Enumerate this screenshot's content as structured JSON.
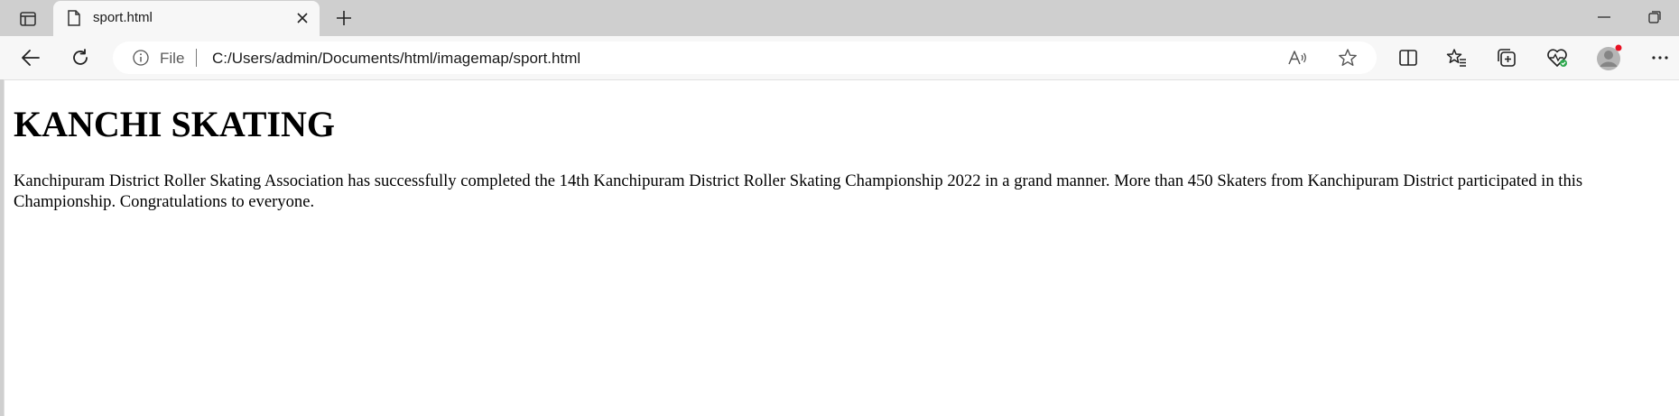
{
  "browser": {
    "tab": {
      "title": "sport.html"
    },
    "address": {
      "scheme_label": "File",
      "url": "C:/Users/admin/Documents/html/imagemap/sport.html"
    }
  },
  "page": {
    "heading": "KANCHI SKATING",
    "paragraph": "Kanchipuram District Roller Skating Association has successfully completed the 14th Kanchipuram District Roller Skating Championship 2022 in a grand manner. More than 450 Skaters from Kanchipuram District participated in this Championship. Congratulations to everyone."
  },
  "colors": {
    "tabstrip_bg": "#cfcfcf",
    "toolbar_bg": "#f7f7f7",
    "profile_badge": "#e81123",
    "health_badge": "#2fa84f"
  },
  "icons": [
    "tab-actions-icon",
    "file-icon",
    "close-icon",
    "plus-icon",
    "minimize-icon",
    "restore-icon",
    "back-arrow-icon",
    "refresh-icon",
    "info-icon",
    "read-aloud-icon",
    "star-icon",
    "split-screen-icon",
    "favorites-icon",
    "collections-icon",
    "browser-essentials-icon",
    "profile-avatar-icon",
    "more-icon"
  ]
}
